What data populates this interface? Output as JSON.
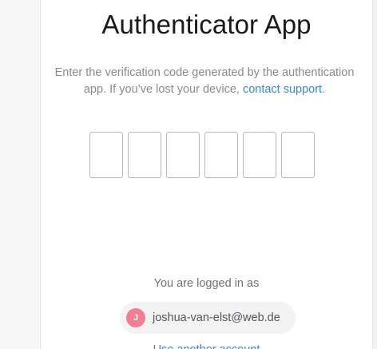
{
  "title": "Authenticator App",
  "description": {
    "text": "Enter the verification code generated by the authentication app. If you’ve lost your device, ",
    "link": "contact support",
    "end": "."
  },
  "code_inputs": [
    "",
    "",
    "",
    "",
    "",
    ""
  ],
  "account": {
    "label": "You are logged in as",
    "avatar_initial": "J",
    "email": "joshua-van-elst@web.de",
    "avatar_color": "#f07f93"
  },
  "bottom_link": "Use another account",
  "colors": {
    "link": "#3a86d8",
    "title": "#1a1a1a",
    "body": "#8a8a8e"
  }
}
